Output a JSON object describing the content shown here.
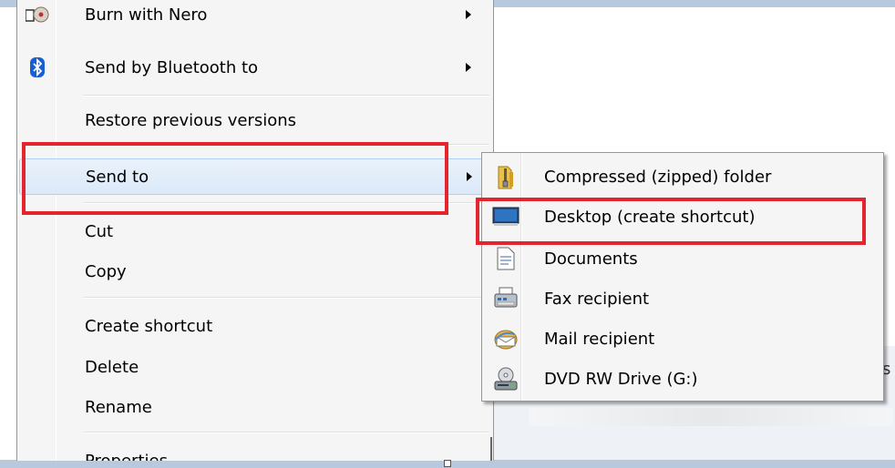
{
  "context_menu": {
    "items": [
      {
        "label": "Burn with Nero",
        "icon": "nero-burn-icon",
        "has_submenu": true
      },
      {
        "label": "Send by Bluetooth to",
        "icon": "bluetooth-icon",
        "has_submenu": true
      },
      {
        "label": "Restore previous versions",
        "icon": "",
        "has_submenu": false
      },
      {
        "label": "Send to",
        "icon": "",
        "has_submenu": true,
        "highlighted": true
      },
      {
        "label": "Cut",
        "icon": "",
        "has_submenu": false
      },
      {
        "label": "Copy",
        "icon": "",
        "has_submenu": false
      },
      {
        "label": "Create shortcut",
        "icon": "",
        "has_submenu": false
      },
      {
        "label": "Delete",
        "icon": "",
        "has_submenu": false
      },
      {
        "label": "Rename",
        "icon": "",
        "has_submenu": false
      },
      {
        "label": "Properties",
        "icon": "",
        "has_submenu": false
      }
    ]
  },
  "send_to_submenu": {
    "items": [
      {
        "label": "Compressed (zipped) folder",
        "icon": "zip-folder-icon"
      },
      {
        "label": "Desktop (create shortcut)",
        "icon": "desktop-icon"
      },
      {
        "label": "Documents",
        "icon": "documents-icon"
      },
      {
        "label": "Fax recipient",
        "icon": "fax-icon"
      },
      {
        "label": "Mail recipient",
        "icon": "mail-icon"
      },
      {
        "label": "DVD RW Drive (G:)",
        "icon": "dvd-drive-icon"
      }
    ]
  },
  "background": {
    "right_edge_text": "s"
  },
  "colors": {
    "highlight_red": "#e3262d",
    "menu_bg": "#f5f5f5",
    "hover_bg": "#dbe9f9",
    "window_frame": "#b9c9dd"
  }
}
